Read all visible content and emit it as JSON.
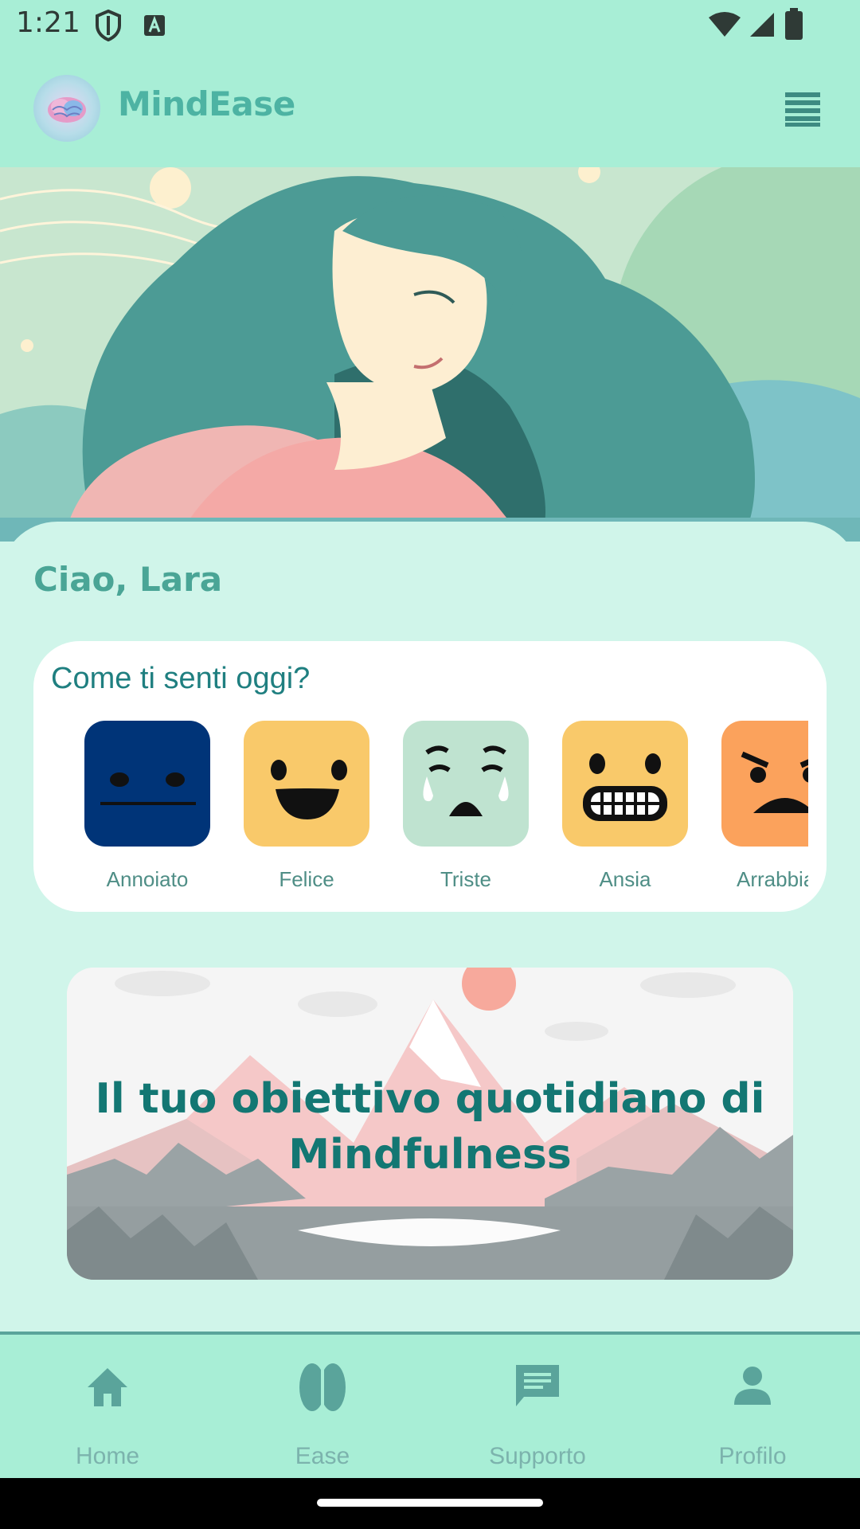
{
  "status_bar": {
    "time": "1:21"
  },
  "app_bar": {
    "title": "MindEase"
  },
  "greeting": "Ciao, Lara",
  "mood": {
    "title": "Come ti senti oggi?",
    "items": [
      {
        "label": "Annoiato",
        "color": "#003478"
      },
      {
        "label": "Felice",
        "color": "#f9c96a"
      },
      {
        "label": "Triste",
        "color": "#bfe3d0"
      },
      {
        "label": "Ansia",
        "color": "#f9c96a"
      },
      {
        "label": "Arrabbiato",
        "color": "#fba25c"
      }
    ]
  },
  "goal_card": {
    "line1": "Il tuo obiettivo quotidiano di",
    "line2": "Mindfulness"
  },
  "bottom_nav": {
    "items": [
      {
        "label": "Home",
        "icon": "home-icon"
      },
      {
        "label": "Ease",
        "icon": "brain-icon"
      },
      {
        "label": "Supporto",
        "icon": "chat-icon"
      },
      {
        "label": "Profilo",
        "icon": "person-icon"
      }
    ]
  },
  "colors": {
    "accent": "#4db3a3",
    "app_bar": "#a8eed6",
    "background": "#d0f5ea",
    "goal_text": "#137773"
  }
}
